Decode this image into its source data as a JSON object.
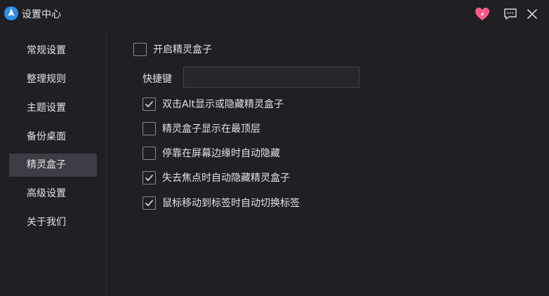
{
  "window": {
    "title": "设置中心",
    "icons": {
      "logo": "app-logo-icon",
      "heart": "heart-icon",
      "feedback": "feedback-icon",
      "close": "close-icon"
    },
    "colors": {
      "accent": "#2f8fe8",
      "heart": "#ff5b8a",
      "active_nav": "#3d3d45",
      "background": "#1f1f24"
    }
  },
  "sidebar": {
    "items": [
      {
        "label": "常规设置",
        "active": false
      },
      {
        "label": "整理规则",
        "active": false
      },
      {
        "label": "主题设置",
        "active": false
      },
      {
        "label": "备份桌面",
        "active": false
      },
      {
        "label": "精灵盒子",
        "active": true
      },
      {
        "label": "高级设置",
        "active": false
      },
      {
        "label": "关于我们",
        "active": false
      }
    ]
  },
  "content": {
    "enable": {
      "label": "开启精灵盒子",
      "checked": false
    },
    "hotkey": {
      "label": "快捷键",
      "value": "",
      "placeholder": ""
    },
    "options": [
      {
        "label": "双击Alt显示或隐藏精灵盒子",
        "checked": true
      },
      {
        "label": "精灵盒子显示在最顶层",
        "checked": false
      },
      {
        "label": "停靠在屏幕边缘时自动隐藏",
        "checked": false
      },
      {
        "label": "失去焦点时自动隐藏精灵盒子",
        "checked": true
      },
      {
        "label": "鼠标移动到标签时自动切换标签",
        "checked": true
      }
    ]
  }
}
